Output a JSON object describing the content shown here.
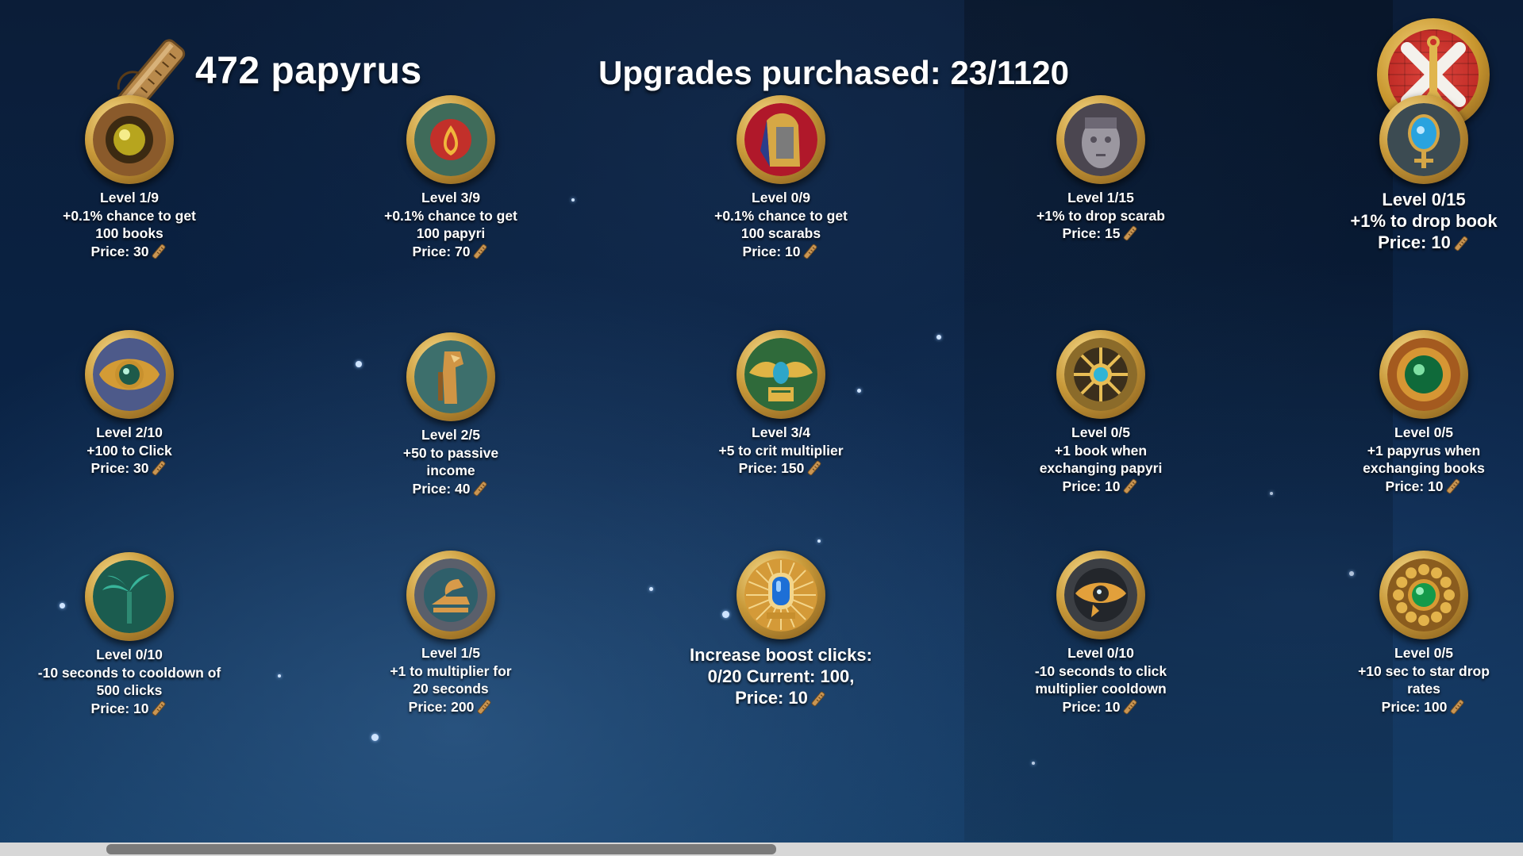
{
  "header": {
    "papyrus_count": "472 papyrus",
    "upgrades_purchased": "Upgrades purchased: 23/1120"
  },
  "colors": {
    "text": "#ffffff",
    "gold_rim": "#c99a3a",
    "close_button_red": "#c8302a",
    "background": "#0b2142"
  },
  "scrollbar": {
    "position_fraction": 0.07,
    "thumb_fraction": 0.44
  },
  "upgrades": [
    {
      "icon": "amber-orb-icon",
      "lines": [
        "Level 1/9",
        "+0.1% chance to get",
        "100 books"
      ],
      "price": "Price: 30"
    },
    {
      "icon": "red-seed-icon",
      "lines": [
        "Level 3/9",
        "+0.1% chance to get",
        "100 papyri"
      ],
      "price": "Price: 70"
    },
    {
      "icon": "pharaoh-head-icon",
      "lines": [
        "Level 0/9",
        "+0.1% chance to get",
        "100 scarabs"
      ],
      "price": "Price: 10"
    },
    {
      "icon": "stone-face-icon",
      "lines": [
        "Level 1/15",
        "+1% to drop scarab"
      ],
      "price": "Price: 15"
    },
    {
      "icon": "ankh-mirror-icon",
      "lines": [
        "Level 0/15",
        "+1% to drop book"
      ],
      "price": "Price: 10"
    },
    {
      "icon": "winged-gem-icon",
      "lines": [
        "Level 2/10",
        "+100 to Click"
      ],
      "price": "Price: 30"
    },
    {
      "icon": "horus-figure-icon",
      "lines": [
        "Level 2/5",
        "+50 to passive",
        "income"
      ],
      "price": "Price: 40"
    },
    {
      "icon": "winged-scarab-icon",
      "lines": [
        "Level 3/4",
        "+5 to crit multiplier"
      ],
      "price": "Price: 150"
    },
    {
      "icon": "sun-disk-icon",
      "lines": [
        "Level 0/5",
        "+1 book when",
        "exchanging papyri"
      ],
      "price": "Price: 10"
    },
    {
      "icon": "emerald-ring-icon",
      "lines": [
        "Level 0/5",
        "+1 papyrus when",
        "exchanging books"
      ],
      "price": "Price: 10"
    },
    {
      "icon": "palm-tree-icon",
      "lines": [
        "Level 0/10",
        "-10 seconds to cooldown of",
        "500 clicks"
      ],
      "price": "Price: 10"
    },
    {
      "icon": "ibis-emblem-icon",
      "lines": [
        "Level 1/5",
        "+1 to multiplier for",
        "20 seconds"
      ],
      "price": "Price: 200"
    },
    {
      "icon": "blue-gem-shrine-icon",
      "lines": [
        "Increase boost clicks:",
        "0/20 Current: 100,"
      ],
      "price": "Price: 10"
    },
    {
      "icon": "eye-of-horus-icon",
      "lines": [
        "Level 0/10",
        "-10 seconds to click",
        "multiplier cooldown"
      ],
      "price": "Price: 10"
    },
    {
      "icon": "green-jewel-icon",
      "lines": [
        "Level 0/5",
        "+10 sec to star drop",
        "rates"
      ],
      "price": "Price: 100"
    }
  ]
}
